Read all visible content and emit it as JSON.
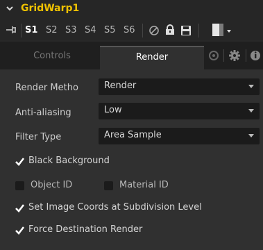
{
  "header": {
    "title": "GridWarp1",
    "collapse_icon": "chevron-down-icon"
  },
  "version_bar": {
    "slots": [
      "S1",
      "S2",
      "S3",
      "S4",
      "S5",
      "S6"
    ],
    "active_slot": "S1",
    "icons": [
      "pin-icon",
      "disable-icon",
      "lock-icon",
      "save-icon",
      "color-swatch",
      "caret-down-icon"
    ]
  },
  "tabs": {
    "controls": "Controls",
    "render": "Render",
    "active": "Render",
    "extra_icons": [
      "settings-icon",
      "gear-icon",
      "info-icon"
    ]
  },
  "fields": {
    "render_method": {
      "label": "Render Metho",
      "value": "Render"
    },
    "anti_aliasing": {
      "label": "Anti-aliasing",
      "value": "Low"
    },
    "filter_type": {
      "label": "Filter Type",
      "value": "Area Sample"
    }
  },
  "checkboxes": {
    "black_background": {
      "label": "Black Background",
      "checked": true
    },
    "object_id": {
      "label": "Object ID",
      "checked": false
    },
    "material_id": {
      "label": "Material ID",
      "checked": false
    },
    "set_image_coords": {
      "label": "Set Image Coords at Subdivision Level",
      "checked": true
    },
    "force_destination": {
      "label": "Force Destination Render",
      "checked": true
    }
  },
  "colors": {
    "title": "#f0c200",
    "panel_bg": "#303030",
    "combo_bg": "#1b1b1b"
  }
}
